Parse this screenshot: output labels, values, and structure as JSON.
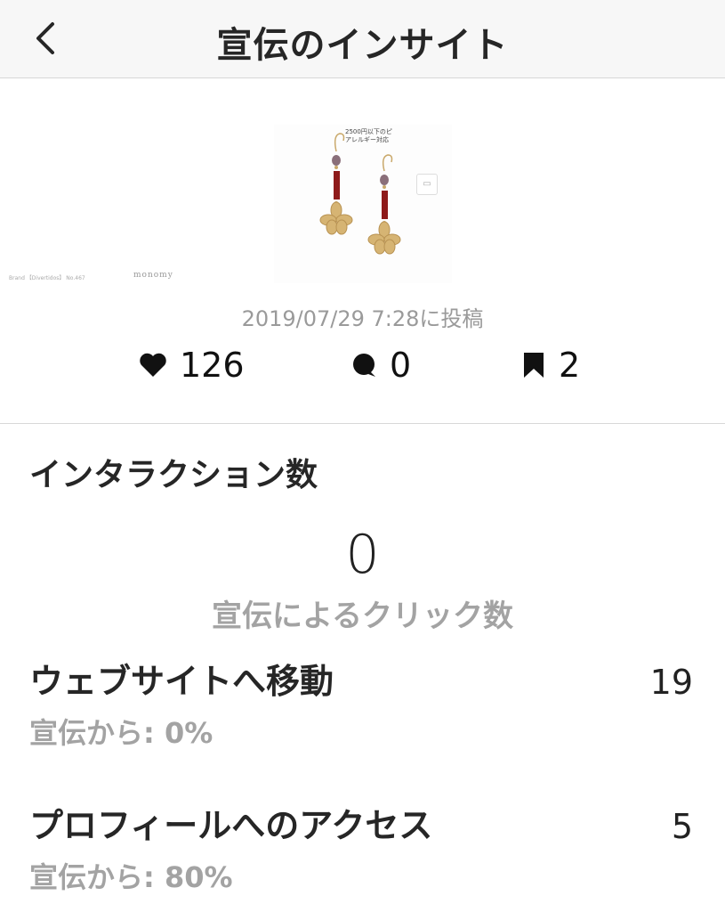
{
  "header": {
    "title": "宣伝のインサイト",
    "back_icon": "chevron-left-icon"
  },
  "post": {
    "thumbnail_caption_line1": "2500円以下のピ",
    "thumbnail_caption_line2": "アレルギー対応",
    "thumbnail_brand": "Brand 【Divertidos】 No.467",
    "thumbnail_logo": "monomy",
    "posted_date": "2019/07/29 7:28に投稿",
    "stats": {
      "likes": "126",
      "comments": "0",
      "saves": "2"
    }
  },
  "interactions": {
    "title": "インタラクション数",
    "total": "0",
    "total_label": "宣伝によるクリック数",
    "metrics": [
      {
        "label": "ウェブサイトへ移動",
        "value": "19",
        "sub": "宣伝から: 0%"
      },
      {
        "label": "プロフィールへのアクセス",
        "value": "5",
        "sub": "宣伝から: 80%"
      }
    ]
  },
  "colors": {
    "header_bg": "#f7f7f7",
    "text_primary": "#262626",
    "text_secondary": "#a3a3a3",
    "divider": "#d8d8d8"
  }
}
